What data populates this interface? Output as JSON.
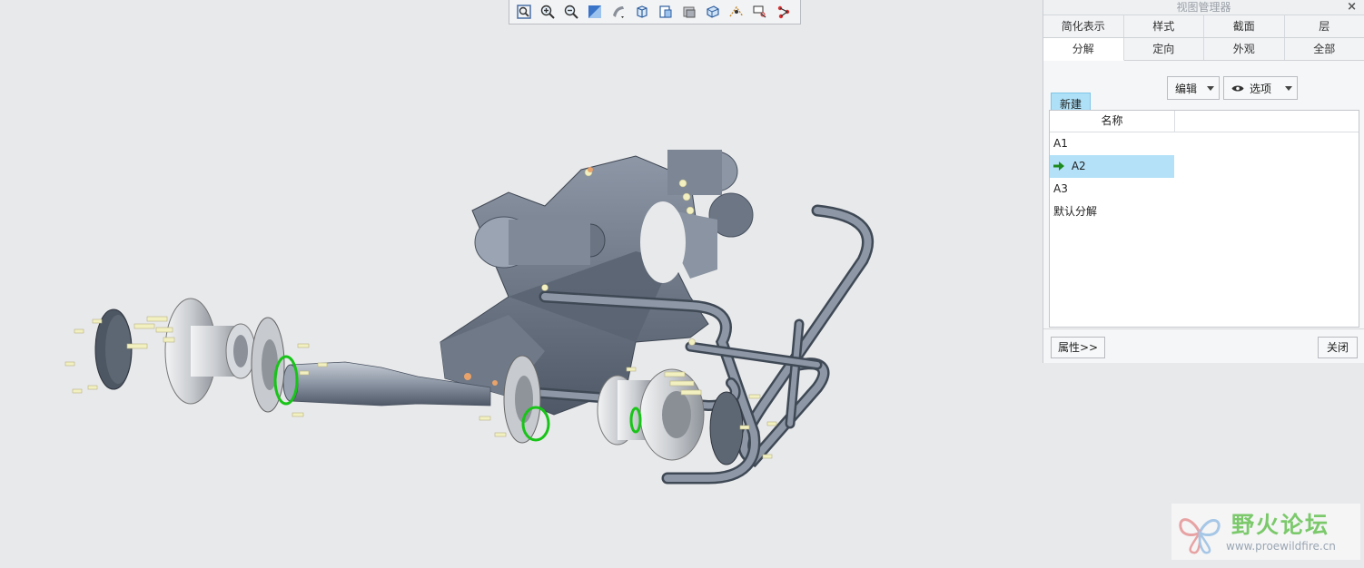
{
  "toolbar": {
    "icons": [
      "zoom-fit-icon",
      "zoom-in-icon",
      "zoom-out-icon",
      "repaint-icon",
      "display-style-icon",
      "saved-orientation-icon",
      "view-manager-icon",
      "layer-icon",
      "perspective-icon",
      "datum-display-icon",
      "annotation-icon",
      "spin-center-icon"
    ]
  },
  "panel": {
    "title": "视图管理器",
    "close": "×",
    "tabs_row1": [
      "简化表示",
      "样式",
      "截面",
      "层"
    ],
    "tabs_row2": [
      "分解",
      "定向",
      "外观",
      "全部"
    ],
    "new_label": "新建",
    "edit_label": "编辑",
    "options_label": "选项",
    "column_name": "名称",
    "items": [
      "A1",
      "A2",
      "A3",
      "默认分解"
    ],
    "selected_index": 1,
    "properties_label": "属性>>",
    "close_label": "关闭"
  },
  "watermark": {
    "title": "野火论坛",
    "url": "www.proewildfire.cn"
  },
  "colors": {
    "selection": "#b4e1f8",
    "new_button": "#aee0f7",
    "model_gray": "#6b7280",
    "seal_green": "#19c419",
    "bolt_yellow": "#f2efc0"
  }
}
